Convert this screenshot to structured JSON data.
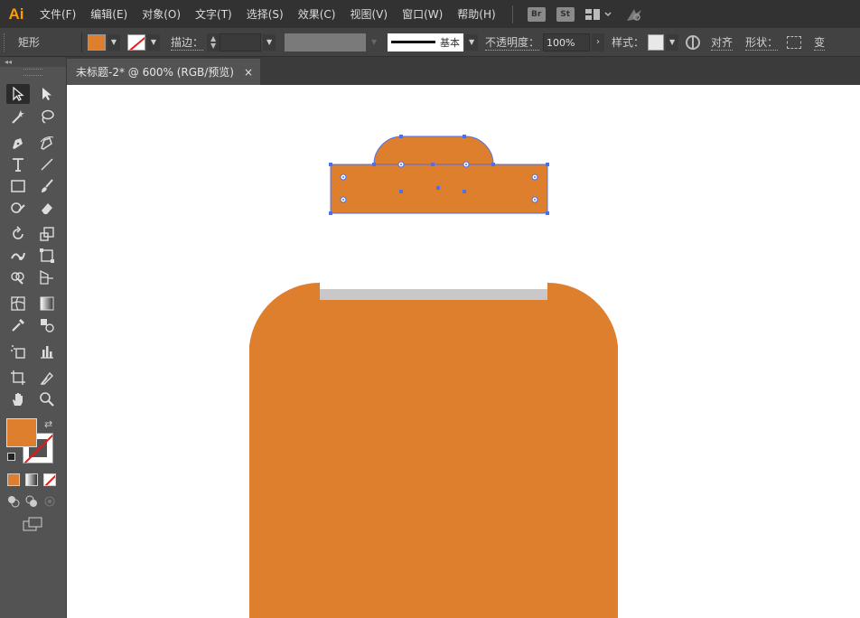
{
  "app": {
    "logo": "Ai"
  },
  "menu": {
    "items": [
      "文件(F)",
      "编辑(E)",
      "对象(O)",
      "文字(T)",
      "选择(S)",
      "效果(C)",
      "视图(V)",
      "窗口(W)",
      "帮助(H)"
    ],
    "bridge": "Br",
    "stock": "St"
  },
  "control": {
    "tool_name": "矩形",
    "stroke_label": "描边：",
    "profile_label": "基本",
    "opacity_label": "不透明度：",
    "opacity_value": "100%",
    "style_label": "样式：",
    "align_label": "对齐",
    "shape_label": "形状：",
    "transform_label": "变"
  },
  "tab": {
    "title": "未标题-2* @ 600% (RGB/预览)",
    "close": "×"
  },
  "colors": {
    "fill": "#de7f2e",
    "selection": "#4a6ff0",
    "lid": "#c8c8c8"
  },
  "icons": [
    "selection-icon",
    "direct-selection-icon",
    "magic-wand-icon",
    "lasso-icon",
    "pen-icon",
    "curvature-icon",
    "type-icon",
    "line-icon",
    "rectangle-icon",
    "paintbrush-icon",
    "shaper-icon",
    "eraser-icon",
    "rotate-icon",
    "scale-icon",
    "warp-icon",
    "free-transform-icon",
    "shape-builder-icon",
    "perspective-icon",
    "mesh-icon",
    "gradient-icon",
    "eyedropper-icon",
    "blend-icon",
    "symbol-sprayer-icon",
    "column-graph-icon",
    "artboard-icon",
    "slice-icon",
    "hand-icon",
    "zoom-icon"
  ]
}
